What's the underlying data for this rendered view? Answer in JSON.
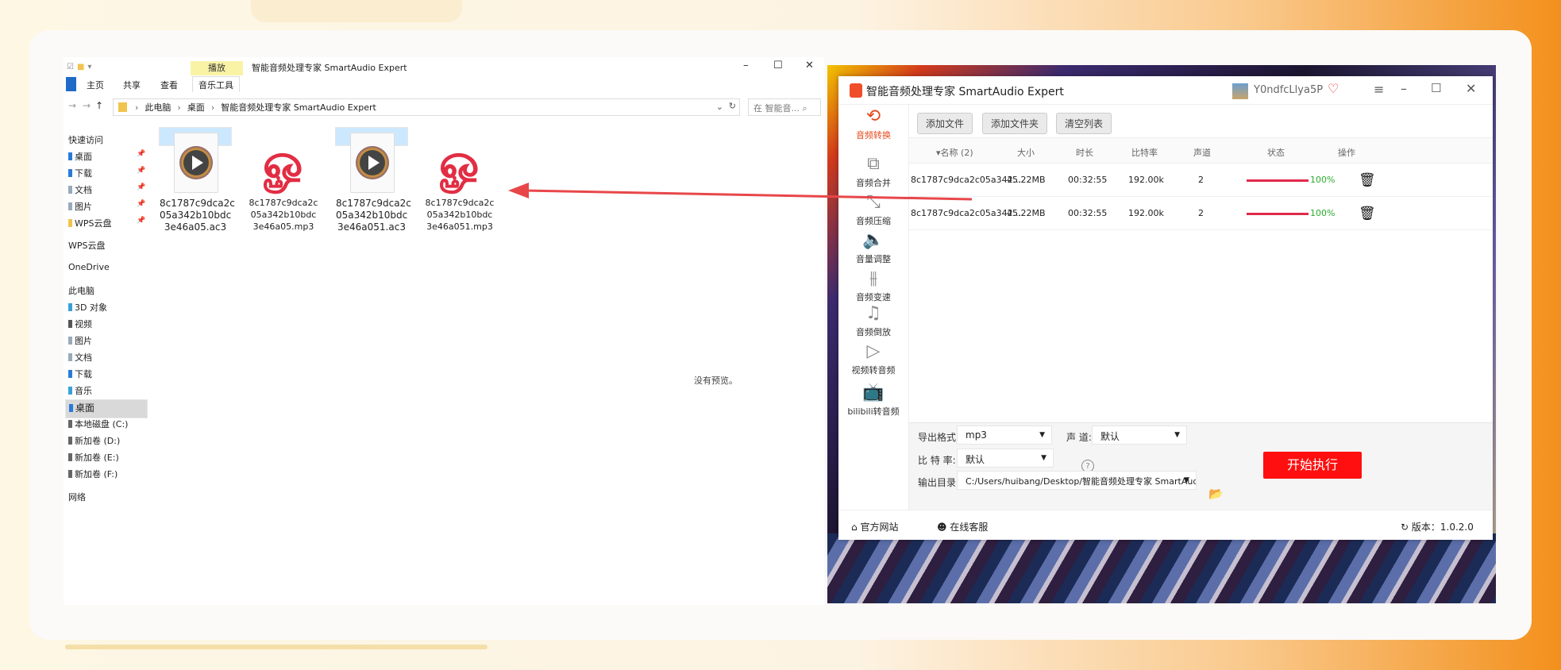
{
  "explorer": {
    "ribbon_context": "播放",
    "title": "智能音频处理专家 SmartAudio Expert",
    "tabs": [
      "主页",
      "共享",
      "查看",
      "音乐工具"
    ],
    "address": [
      "此电脑",
      "桌面",
      "智能音频处理专家 SmartAudio Expert"
    ],
    "search_placeholder": "在 智能音...",
    "nav": {
      "quick_access": "快速访问",
      "quick_items": [
        "桌面",
        "下载",
        "文档",
        "图片",
        "WPS云盘"
      ],
      "wps": "WPS云盘",
      "onedrive": "OneDrive",
      "this_pc": "此电脑",
      "pc_items": [
        "3D 对象",
        "视频",
        "图片",
        "文档",
        "下载",
        "音乐",
        "桌面",
        "本地磁盘 (C:)",
        "新加卷 (D:)",
        "新加卷 (E:)",
        "新加卷 (F:)"
      ],
      "network": "网络"
    },
    "files": [
      {
        "line1": "8c1787c9dca2c",
        "line2": "05a342b10bdc",
        "line3": "3e46a05.ac3",
        "type": "ac3",
        "selected": true
      },
      {
        "line1": "8c1787c9dca2c",
        "line2": "05a342b10bdc",
        "line3": "3e46a05.mp3",
        "type": "mp3",
        "selected": false
      },
      {
        "line1": "8c1787c9dca2c",
        "line2": "05a342b10bdc",
        "line3": "3e46a051.ac3",
        "type": "ac3",
        "selected": true
      },
      {
        "line1": "8c1787c9dca2c",
        "line2": "05a342b10bdc",
        "line3": "3e46a051.mp3",
        "type": "mp3",
        "selected": false
      }
    ],
    "preview_text": "没有预览。"
  },
  "app": {
    "title": "智能音频处理专家 SmartAudio Expert",
    "user": "Y0ndfcLlya5P",
    "sidebar": [
      {
        "label": "音频转换",
        "icon": "convert-icon"
      },
      {
        "label": "音频合并",
        "icon": "merge-icon"
      },
      {
        "label": "音频压缩",
        "icon": "compress-icon"
      },
      {
        "label": "音量调整",
        "icon": "volume-icon"
      },
      {
        "label": "音频变速",
        "icon": "speed-icon"
      },
      {
        "label": "音频倒放",
        "icon": "music-note-icon"
      },
      {
        "label": "视频转音频",
        "icon": "play-circle-icon"
      },
      {
        "label": "bilibili转音频",
        "icon": "bilibili-icon"
      }
    ],
    "toolbar": {
      "add_file": "添加文件",
      "add_folder": "添加文件夹",
      "clear_list": "清空列表"
    },
    "table": {
      "headers": {
        "name": "名称 (2)",
        "size": "大小",
        "duration": "时长",
        "bitrate": "比特率",
        "channels": "声道",
        "status": "状态",
        "action": "操作"
      },
      "rows": [
        {
          "name": "8c1787c9dca2c05a342...",
          "size": "45.22MB",
          "duration": "00:32:55",
          "bitrate": "192.00k",
          "channels": "2",
          "progress": "100%"
        },
        {
          "name": "8c1787c9dca2c05a342...",
          "size": "45.22MB",
          "duration": "00:32:55",
          "bitrate": "192.00k",
          "channels": "2",
          "progress": "100%"
        }
      ]
    },
    "settings": {
      "format_label": "导出格式:",
      "format_value": "mp3",
      "channel_label": "声 道:",
      "channel_value": "默认",
      "bitrate_label": "比 特 率:",
      "bitrate_value": "默认",
      "output_label": "输出目录:",
      "output_value": "C:/Users/huibang/Desktop/智能音频处理专家 SmartAudio",
      "start_button": "开始执行"
    },
    "footer": {
      "website": "官方网站",
      "service": "在线客服",
      "version": "版本：1.0.2.0"
    }
  },
  "colors": {
    "accent": "#e44a1c",
    "start_button": "#ff0f0f",
    "progress": "#e02a4b",
    "arrow": "#e8474a"
  }
}
